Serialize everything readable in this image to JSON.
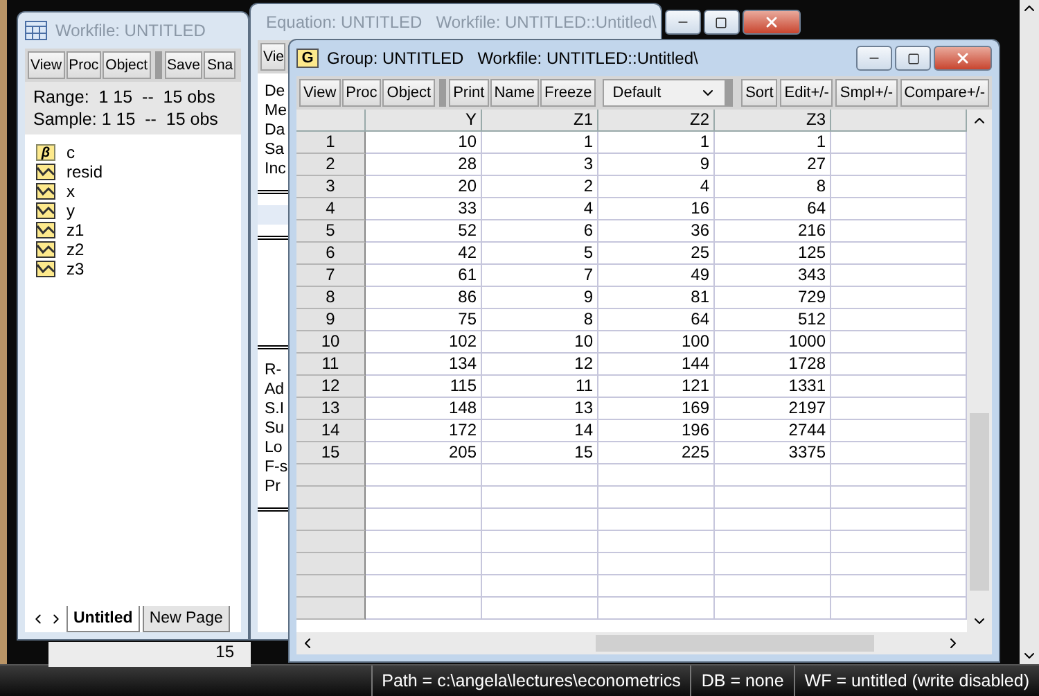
{
  "background_window": {
    "text": "15"
  },
  "workfile": {
    "title": "Workfile: UNTITLED",
    "active": false,
    "toolbar_groups": [
      [
        "View",
        "Proc",
        "Object"
      ],
      [
        "Save",
        "Sna"
      ]
    ],
    "range_label": "Range:",
    "range": "1 15  --  15 obs",
    "sample_label": "Sample:",
    "sample": "1 15  --  15 obs",
    "objects": [
      {
        "kind": "coef",
        "badge": "β",
        "name": "c"
      },
      {
        "kind": "series",
        "name": "resid"
      },
      {
        "kind": "series",
        "name": "x"
      },
      {
        "kind": "series",
        "name": "y"
      },
      {
        "kind": "series",
        "name": "z1"
      },
      {
        "kind": "series",
        "name": "z2"
      },
      {
        "kind": "series",
        "name": "z3"
      }
    ],
    "pages": [
      {
        "label": "Untitled",
        "selected": true
      },
      {
        "label": "New Page",
        "selected": false
      }
    ]
  },
  "equation": {
    "title": "Equation: UNTITLED   Workfile: UNTITLED::Untitled\\",
    "active": false,
    "toolbar": [
      "Vie"
    ],
    "header_lines": [
      "De",
      "Me",
      "Da",
      "Sa",
      "Inc"
    ],
    "stat_lines": [
      "R-",
      "Ad",
      "S.I",
      "Su",
      "Lo",
      "F-s",
      "Pr"
    ]
  },
  "group": {
    "icon_letter": "G",
    "title": "Group: UNTITLED   Workfile: UNTITLED::Untitled\\",
    "active": true,
    "toolbar_groups": [
      [
        "View",
        "Proc",
        "Object"
      ],
      [
        "Print",
        "Name",
        "Freeze"
      ]
    ],
    "dropdown": "Default",
    "toolbar_right": [
      "Sort",
      "Edit+/-",
      "Smpl+/-",
      "Compare+/-"
    ],
    "columns": [
      "Y",
      "Z1",
      "Z2",
      "Z3"
    ],
    "rows": [
      {
        "obs": "1",
        "values": [
          "10",
          "1",
          "1",
          "1"
        ]
      },
      {
        "obs": "2",
        "values": [
          "28",
          "3",
          "9",
          "27"
        ]
      },
      {
        "obs": "3",
        "values": [
          "20",
          "2",
          "4",
          "8"
        ]
      },
      {
        "obs": "4",
        "values": [
          "33",
          "4",
          "16",
          "64"
        ]
      },
      {
        "obs": "5",
        "values": [
          "52",
          "6",
          "36",
          "216"
        ]
      },
      {
        "obs": "6",
        "values": [
          "42",
          "5",
          "25",
          "125"
        ]
      },
      {
        "obs": "7",
        "values": [
          "61",
          "7",
          "49",
          "343"
        ]
      },
      {
        "obs": "8",
        "values": [
          "86",
          "9",
          "81",
          "729"
        ]
      },
      {
        "obs": "9",
        "values": [
          "75",
          "8",
          "64",
          "512"
        ]
      },
      {
        "obs": "10",
        "values": [
          "102",
          "10",
          "100",
          "1000"
        ]
      },
      {
        "obs": "11",
        "values": [
          "134",
          "12",
          "144",
          "1728"
        ]
      },
      {
        "obs": "12",
        "values": [
          "115",
          "11",
          "121",
          "1331"
        ]
      },
      {
        "obs": "13",
        "values": [
          "148",
          "13",
          "169",
          "2197"
        ]
      },
      {
        "obs": "14",
        "values": [
          "172",
          "14",
          "196",
          "2744"
        ]
      },
      {
        "obs": "15",
        "values": [
          "205",
          "15",
          "225",
          "3375"
        ]
      }
    ]
  },
  "status_bar": {
    "path": "Path = c:\\angela\\lectures\\econometrics",
    "db": "DB = none",
    "wf": "WF = untitled (write disabled)"
  }
}
